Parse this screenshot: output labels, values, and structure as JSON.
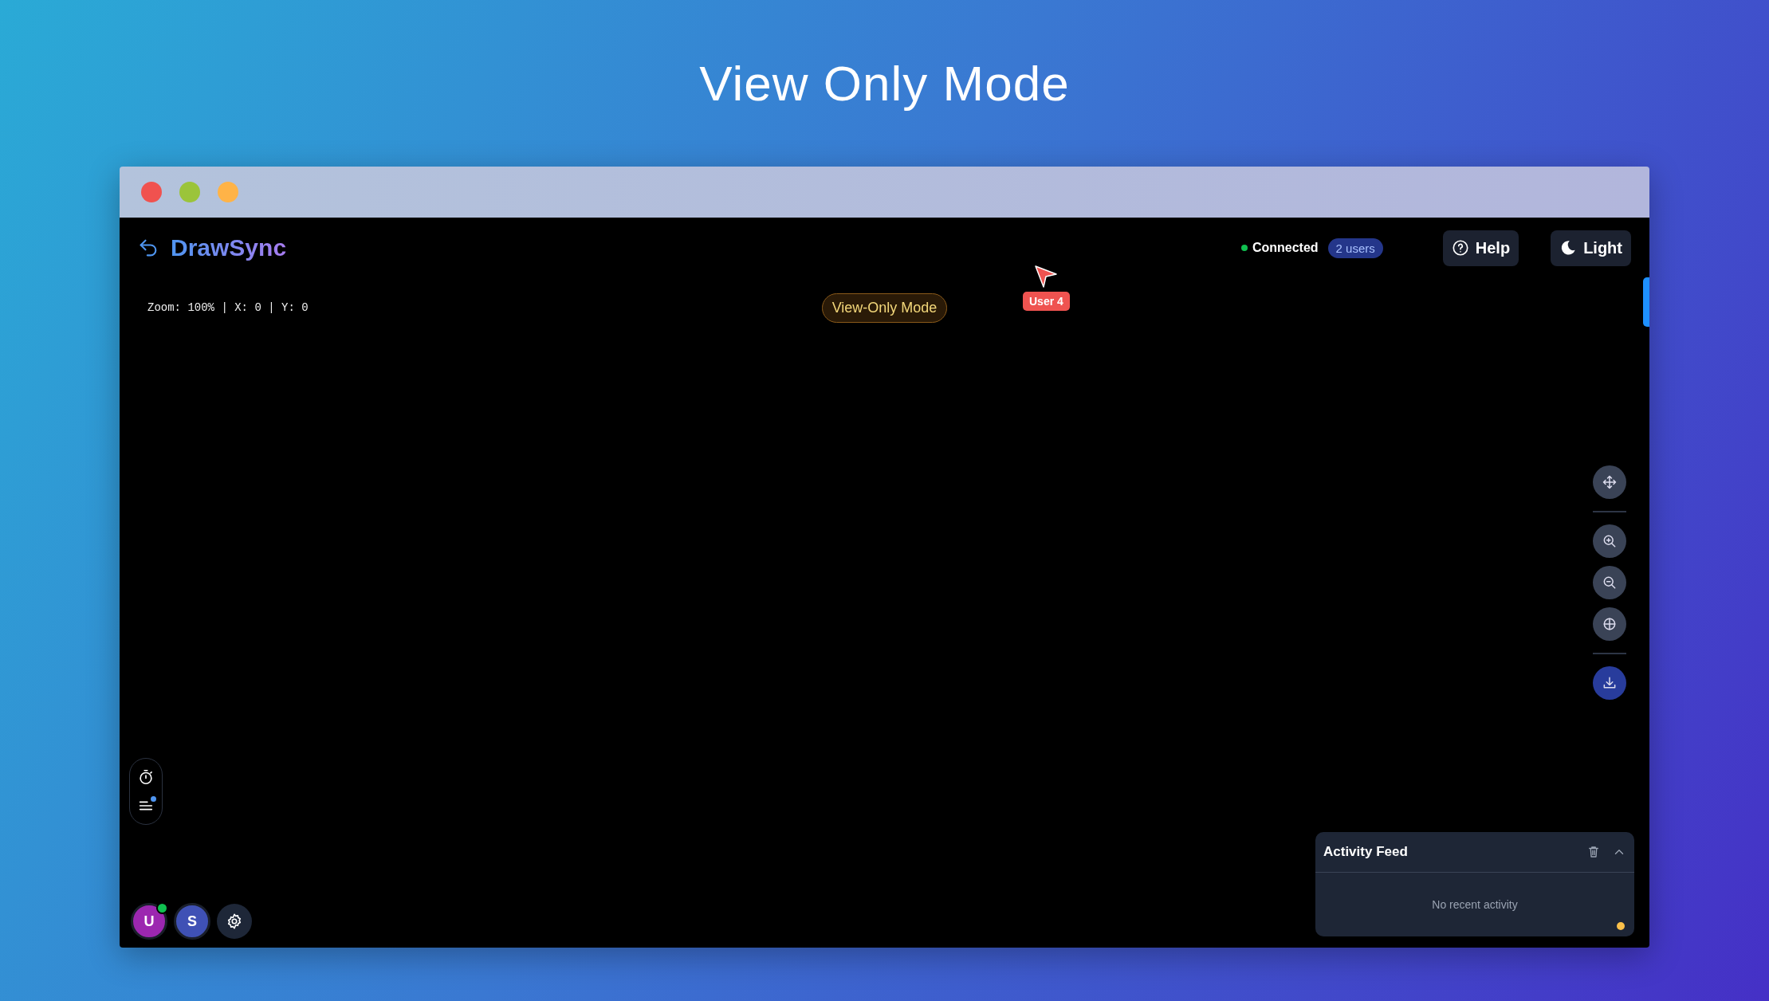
{
  "page_title": "View Only Mode",
  "window": {
    "controls": [
      {
        "color": "#f0524f"
      },
      {
        "color": "#9bc43a"
      },
      {
        "color": "#ffb347"
      }
    ]
  },
  "header": {
    "logo": "DrawSync",
    "status": {
      "label": "Connected",
      "connected": true
    },
    "users_badge": "2 users",
    "buttons": [
      {
        "kind": "help",
        "label": "Help"
      },
      {
        "kind": "theme",
        "label": "Light"
      }
    ]
  },
  "canvas_info": "Zoom: 100% | X: 0 | Y: 0",
  "mode_badge": "View-Only Mode",
  "remote_cursors": [
    {
      "label": "User 4",
      "color": "#ef5350"
    }
  ],
  "tool_groups": [
    [
      {
        "kind": "pan"
      }
    ],
    [
      {
        "kind": "zoom_in"
      },
      {
        "kind": "zoom_out"
      },
      {
        "kind": "recenter"
      }
    ],
    [
      {
        "kind": "download"
      }
    ]
  ],
  "side_tools": [
    {
      "kind": "timer",
      "unread": false
    },
    {
      "kind": "activity_list",
      "unread": true
    }
  ],
  "users": [
    {
      "initial": "U",
      "color": "#9c27b0",
      "online": true
    },
    {
      "initial": "S",
      "color": "#3f51b5",
      "online": false
    }
  ],
  "activity_feed": {
    "title": "Activity Feed",
    "expanded": true,
    "empty_text": "No recent activity"
  }
}
